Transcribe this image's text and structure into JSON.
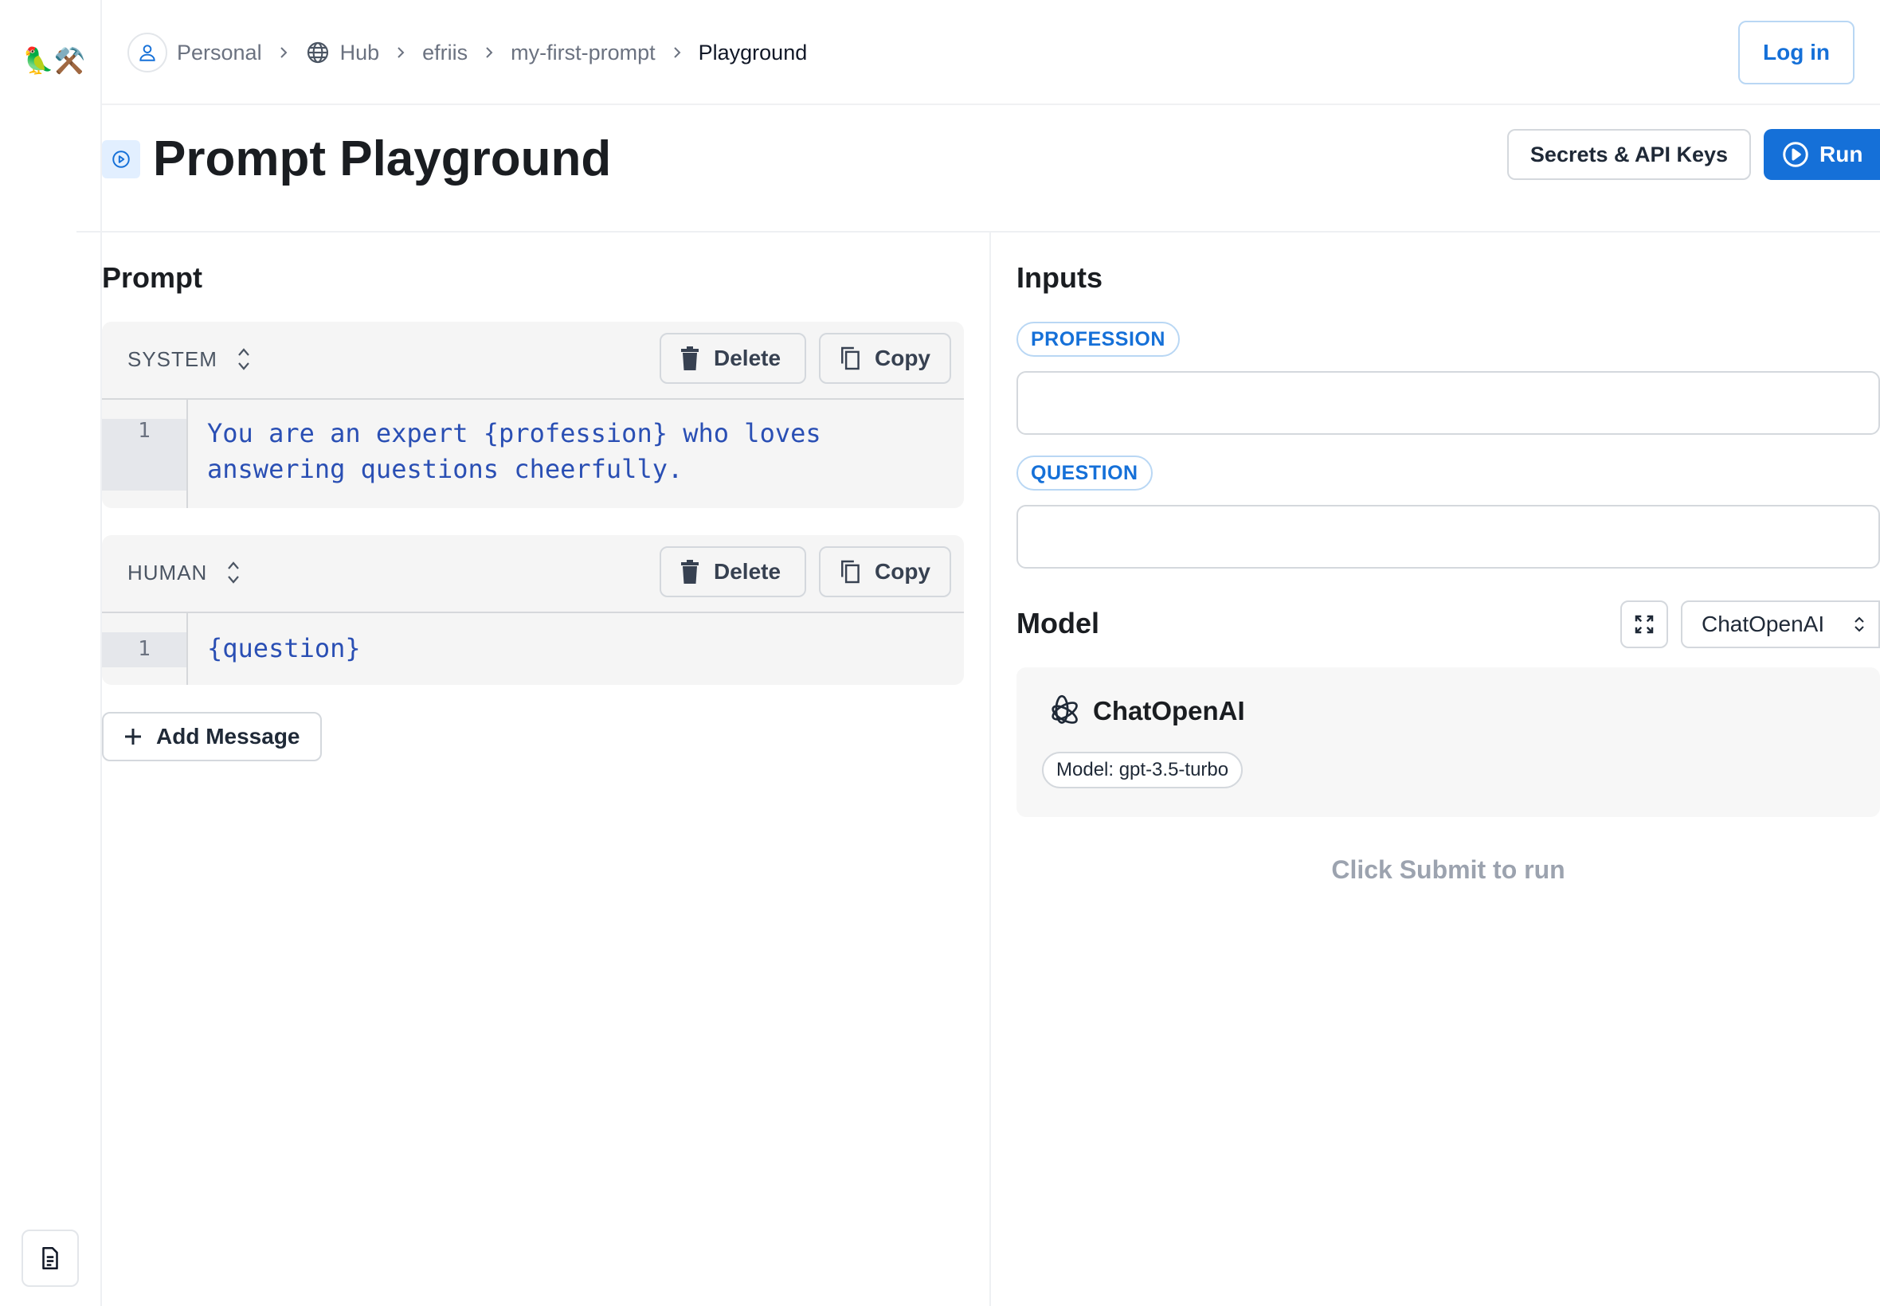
{
  "sidebar": {
    "logo_text": "🦜⚒️",
    "doc_icon": "document-icon"
  },
  "breadcrumb": {
    "items": [
      {
        "label": "Personal",
        "icon": "user-icon"
      },
      {
        "label": "Hub",
        "icon": "globe-icon"
      },
      {
        "label": "efriis"
      },
      {
        "label": "my-first-prompt"
      },
      {
        "label": "Playground"
      }
    ]
  },
  "header": {
    "login_label": "Log in"
  },
  "page": {
    "title": "Prompt Playground",
    "secrets_label": "Secrets & API Keys",
    "run_label": "Run"
  },
  "prompt": {
    "section_title": "Prompt",
    "messages": [
      {
        "role": "SYSTEM",
        "delete_label": "Delete",
        "copy_label": "Copy",
        "line_number": "1",
        "lines": [
          "You are an expert {profession} who loves",
          "answering questions cheerfully."
        ]
      },
      {
        "role": "HUMAN",
        "delete_label": "Delete",
        "copy_label": "Copy",
        "line_number": "1",
        "lines": [
          "{question}"
        ]
      }
    ],
    "add_message_label": "Add Message"
  },
  "inputs": {
    "section_title": "Inputs",
    "fields": [
      {
        "label": "PROFESSION",
        "value": ""
      },
      {
        "label": "QUESTION",
        "value": ""
      }
    ]
  },
  "model": {
    "section_title": "Model",
    "selected": "ChatOpenAI",
    "card_name": "ChatOpenAI",
    "card_detail": "Model: gpt-3.5-turbo",
    "hint": "Click Submit to run"
  },
  "colors": {
    "accent": "#1570d8",
    "code_text": "#2a4fb4",
    "pill_border": "#b9d7f4"
  }
}
